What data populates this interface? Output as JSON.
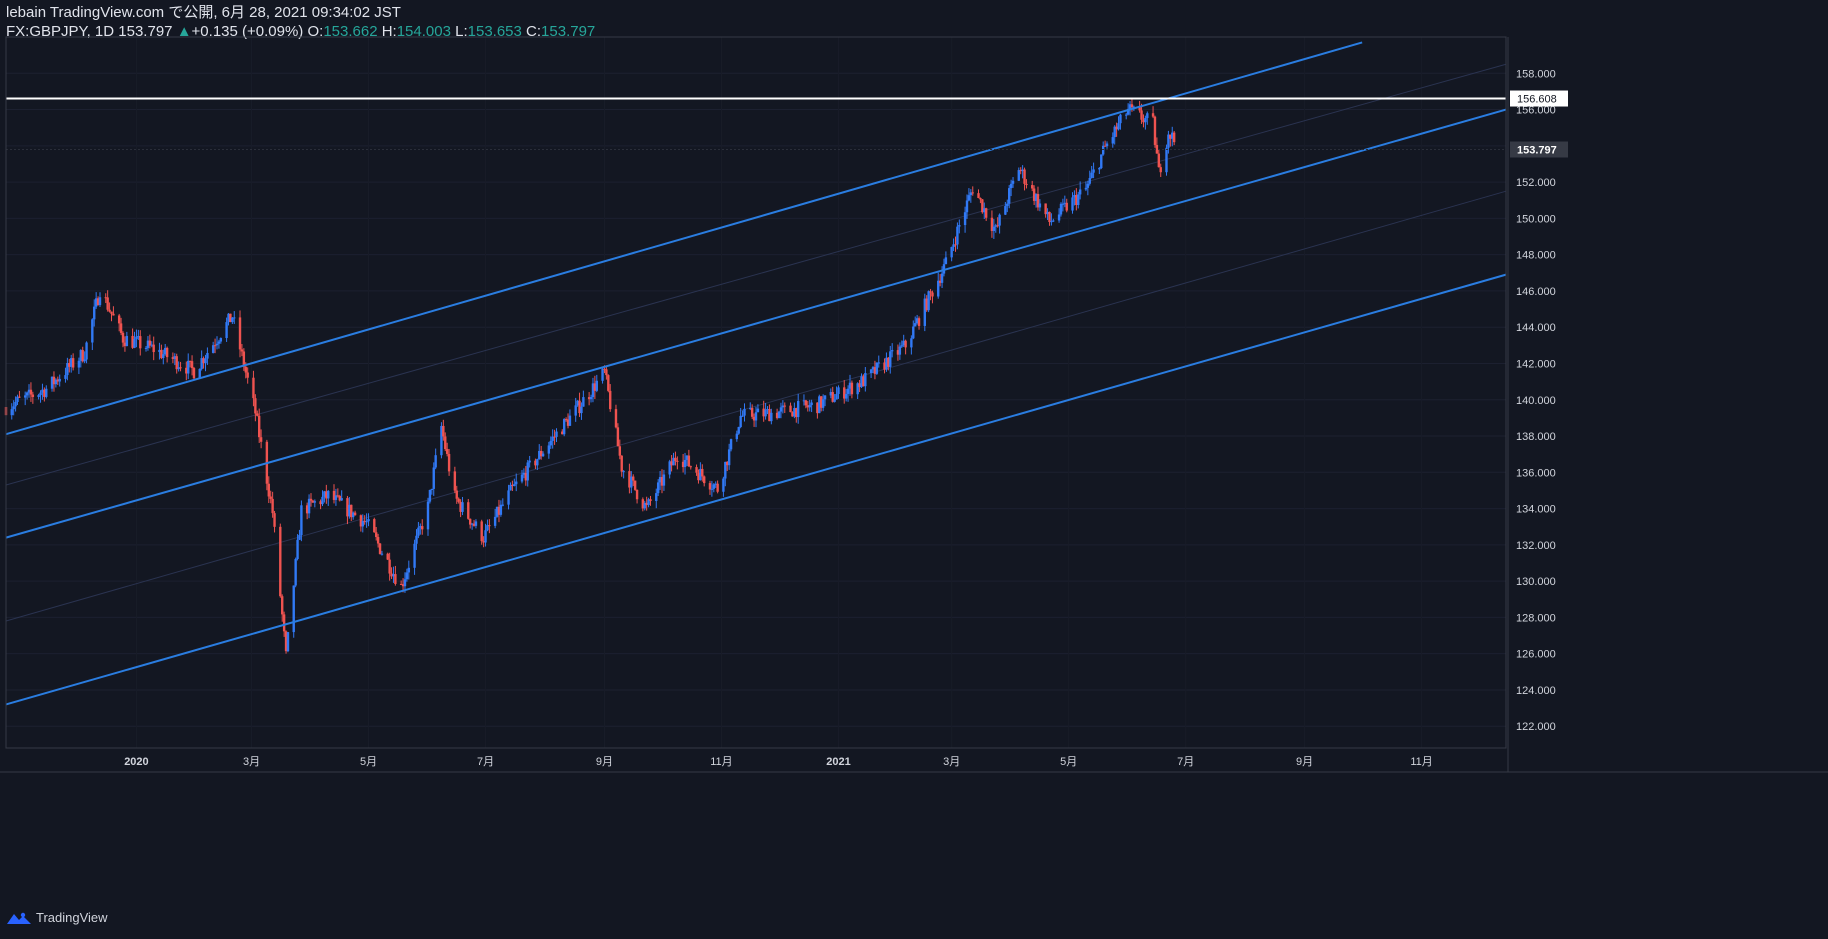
{
  "header": {
    "publish_line": "lebain TradingView.com で公開, 6月 28, 2021 09:34:02 JST",
    "symbol": "FX:GBPJPY, 1D",
    "last": "153.797",
    "change_arrow": "▲",
    "change": "+0.135 (+0.09%)",
    "o_label": "O:",
    "o_value": "153.662",
    "h_label": "H:",
    "h_value": "154.003",
    "l_label": "L:",
    "l_value": "153.653",
    "c_label": "C:",
    "c_value": "153.797"
  },
  "footer": {
    "brand": "TradingView"
  },
  "colors": {
    "background": "#131722",
    "up": "#2962ff",
    "up_candle": "#3179f5",
    "down_candle": "#ef5350",
    "channel": "#2a7de1",
    "text": "#d1d4dc"
  },
  "chart_data": {
    "type": "candlestick",
    "symbol": "GBPJPY",
    "interval": "1D",
    "x_ticks": [
      "2020",
      "3月",
      "5月",
      "7月",
      "9月",
      "11月",
      "2021",
      "3月",
      "5月",
      "7月",
      "9月",
      "11月"
    ],
    "x_tick_dates": [
      "2020-01-01",
      "2020-03-01",
      "2020-05-01",
      "2020-07-01",
      "2020-09-01",
      "2020-11-01",
      "2021-01-01",
      "2021-03-01",
      "2021-05-01",
      "2021-07-01",
      "2021-09-01",
      "2021-11-01"
    ],
    "x_range": [
      "2019-10-25",
      "2021-12-15"
    ],
    "y_range": [
      120.8,
      160.0
    ],
    "y_ticks": [
      122,
      124,
      126,
      128,
      130,
      132,
      134,
      136,
      138,
      140,
      142,
      144,
      146,
      148,
      150,
      152,
      154,
      156,
      158
    ],
    "y_tick_labels": [
      "122.000",
      "124.000",
      "126.000",
      "128.000",
      "130.000",
      "132.000",
      "134.000",
      "136.000",
      "138.000",
      "140.000",
      "142.000",
      "144.000",
      "146.000",
      "148.000",
      "150.000",
      "152.000",
      "154.000",
      "156.000",
      "158.000"
    ],
    "horizontal_line": {
      "value": 156.608,
      "label": "156.608"
    },
    "last_price": {
      "value": 153.797,
      "label": "153.797"
    },
    "channel_lines": [
      {
        "name": "upper",
        "start": [
          "2019-10-25",
          138.1
        ],
        "end": [
          "2021-10-01",
          159.7
        ]
      },
      {
        "name": "middle",
        "start": [
          "2019-10-25",
          132.4
        ],
        "end": [
          "2021-12-15",
          156.0
        ]
      },
      {
        "name": "lower",
        "start": [
          "2019-10-25",
          123.2
        ],
        "end": [
          "2021-12-15",
          146.9
        ]
      }
    ],
    "channel_midlines": [
      {
        "start": [
          "2019-10-25",
          135.3
        ],
        "end": [
          "2021-12-15",
          158.5
        ]
      },
      {
        "start": [
          "2019-10-25",
          127.8
        ],
        "end": [
          "2021-12-15",
          151.5
        ]
      }
    ],
    "price_path": [
      [
        "2019-10-25",
        139.6
      ],
      [
        "2019-11-15",
        140.6
      ],
      [
        "2019-12-05",
        142.6
      ],
      [
        "2019-12-13",
        146.1
      ],
      [
        "2019-12-25",
        143.4
      ],
      [
        "2020-01-10",
        142.8
      ],
      [
        "2020-01-31",
        141.6
      ],
      [
        "2020-02-20",
        144.6
      ],
      [
        "2020-03-03",
        139.3
      ],
      [
        "2020-03-12",
        133.8
      ],
      [
        "2020-03-19",
        125.8
      ],
      [
        "2020-03-27",
        133.9
      ],
      [
        "2020-04-10",
        134.7
      ],
      [
        "2020-04-30",
        133.2
      ],
      [
        "2020-05-18",
        129.7
      ],
      [
        "2020-06-01",
        134.1
      ],
      [
        "2020-06-08",
        138.5
      ],
      [
        "2020-06-15",
        134.6
      ],
      [
        "2020-06-30",
        132.4
      ],
      [
        "2020-07-14",
        134.9
      ],
      [
        "2020-08-03",
        137.6
      ],
      [
        "2020-08-17",
        139.4
      ],
      [
        "2020-09-01",
        141.5
      ],
      [
        "2020-09-10",
        136.3
      ],
      [
        "2020-09-23",
        134.0
      ],
      [
        "2020-10-09",
        137.0
      ],
      [
        "2020-10-30",
        135.1
      ],
      [
        "2020-11-11",
        139.1
      ],
      [
        "2020-11-30",
        139.3
      ],
      [
        "2020-12-21",
        139.7
      ],
      [
        "2021-01-15",
        141.1
      ],
      [
        "2021-02-05",
        143.0
      ],
      [
        "2021-02-26",
        147.5
      ],
      [
        "2021-03-12",
        151.7
      ],
      [
        "2021-03-24",
        149.3
      ],
      [
        "2021-04-05",
        152.8
      ],
      [
        "2021-04-21",
        149.8
      ],
      [
        "2021-05-10",
        151.6
      ],
      [
        "2021-05-20",
        153.9
      ],
      [
        "2021-06-01",
        156.0
      ],
      [
        "2021-06-14",
        155.2
      ],
      [
        "2021-06-17",
        152.5
      ],
      [
        "2021-06-22",
        154.8
      ],
      [
        "2021-06-28",
        153.797
      ]
    ]
  }
}
